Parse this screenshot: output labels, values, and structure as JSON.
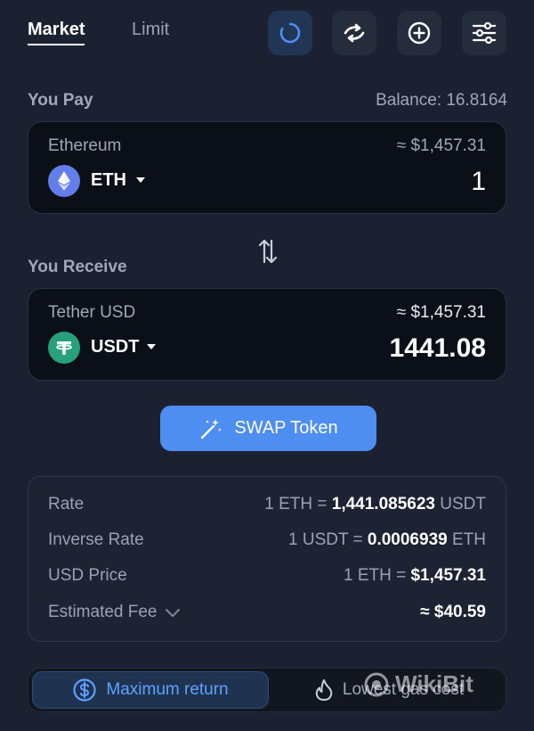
{
  "tabs": {
    "market": "Market",
    "limit": "Limit"
  },
  "toolbar": {
    "icons": [
      "loading-spinner-icon",
      "refresh-arrows-icon",
      "add-circle-icon",
      "sliders-settings-icon"
    ],
    "accent": "#4e8ef0"
  },
  "pay": {
    "label": "You Pay",
    "balance": "Balance: 16.8164",
    "token_name": "Ethereum",
    "usd_value": "≈ $1,457.31",
    "symbol": "ETH",
    "amount": "1"
  },
  "receive": {
    "label": "You Receive",
    "token_name": "Tether USD",
    "usd_value": "≈ $1,457.31",
    "symbol": "USDT",
    "amount": "1441.08"
  },
  "swap_button": {
    "label": "SWAP Token"
  },
  "info": {
    "rate": {
      "key": "Rate",
      "prefix": "1 ETH = ",
      "value": "1,441.085623",
      "suffix": " USDT"
    },
    "inverse_rate": {
      "key": "Inverse Rate",
      "prefix": "1 USDT = ",
      "value": "0.0006939",
      "suffix": " ETH"
    },
    "usd_price": {
      "key": "USD Price",
      "prefix": "1 ETH = ",
      "value": "$1,457.31",
      "suffix": ""
    },
    "fee": {
      "key": "Estimated Fee",
      "prefix": "≈ ",
      "value": "$40.59",
      "suffix": ""
    }
  },
  "modes": {
    "max_return": "Maximum return",
    "lowest_gas": "Lowest gas cost"
  },
  "watermark": "WikiBit"
}
